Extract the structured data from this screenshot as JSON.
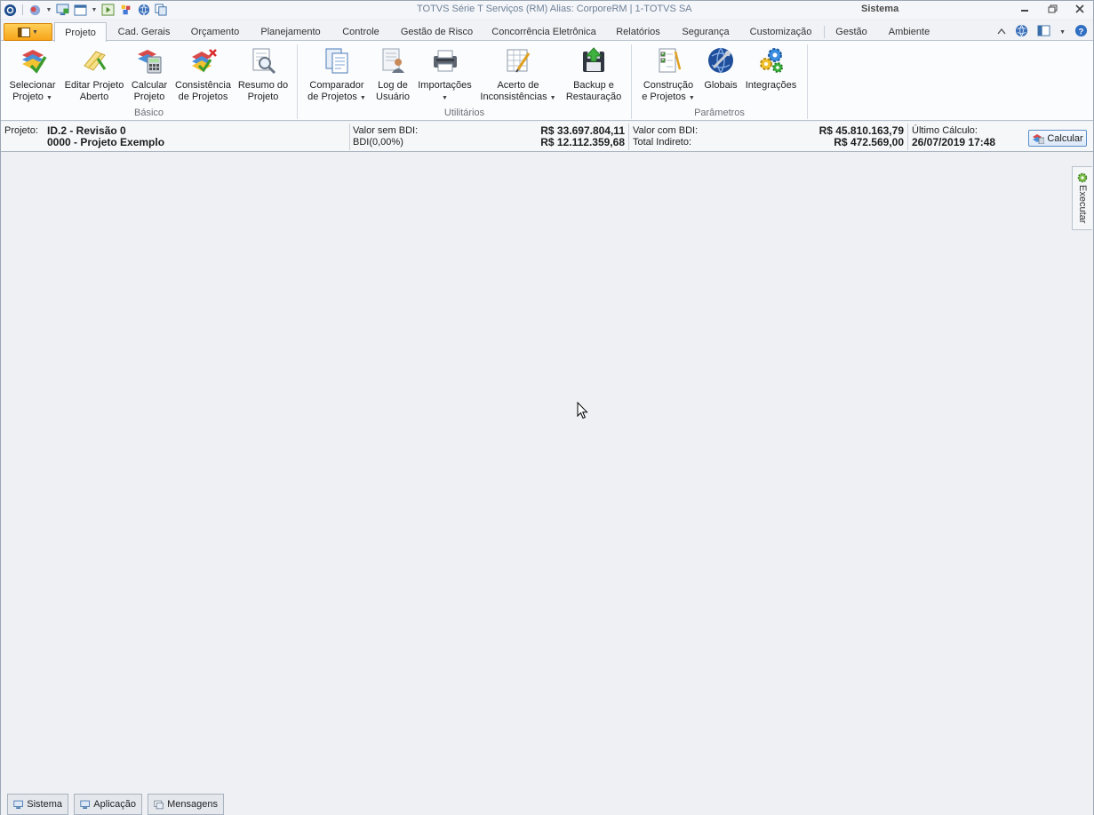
{
  "window": {
    "title": "TOTVS Série T Serviços (RM) Alias: CorporeRM | 1-TOTVS SA",
    "app_name": "Sistema"
  },
  "tabs": [
    {
      "label": "Projeto",
      "active": true
    },
    {
      "label": "Cad. Gerais"
    },
    {
      "label": "Orçamento"
    },
    {
      "label": "Planejamento"
    },
    {
      "label": "Controle"
    },
    {
      "label": "Gestão de Risco"
    },
    {
      "label": "Concorrência Eletrônica"
    },
    {
      "label": "Relatórios"
    },
    {
      "label": "Segurança"
    },
    {
      "label": "Customização"
    },
    {
      "label": "Gestão"
    },
    {
      "label": "Ambiente"
    }
  ],
  "ribbon": {
    "groups": [
      {
        "label": "Básico"
      },
      {
        "label": "Utilitários"
      },
      {
        "label": "Parâmetros"
      }
    ],
    "buttons": [
      {
        "line1": "Selecionar",
        "line2": "Projeto",
        "dropdown": true,
        "icon": "select-project-icon"
      },
      {
        "line1": "Editar Projeto",
        "line2": "Aberto",
        "icon": "edit-project-icon"
      },
      {
        "line1": "Calcular",
        "line2": "Projeto",
        "icon": "calculate-project-icon"
      },
      {
        "line1": "Consistência",
        "line2": "de Projetos",
        "icon": "consistency-icon"
      },
      {
        "line1": "Resumo do",
        "line2": "Projeto",
        "icon": "project-summary-icon"
      },
      {
        "line1": "Comparador",
        "line2": "de Projetos",
        "dropdown": true,
        "icon": "compare-icon"
      },
      {
        "line1": "Log de",
        "line2": "Usuário",
        "icon": "user-log-icon"
      },
      {
        "line1": "Importações",
        "line2": "",
        "dropdown": true,
        "icon": "import-icon"
      },
      {
        "line1": "Acerto de",
        "line2": "Inconsistências",
        "dropdown": true,
        "icon": "fix-inconsistencies-icon"
      },
      {
        "line1": "Backup e",
        "line2": "Restauração",
        "icon": "backup-icon"
      },
      {
        "line1": "Construção",
        "line2": "e Projetos",
        "dropdown": true,
        "icon": "construction-icon"
      },
      {
        "line1": "Globais",
        "line2": "",
        "icon": "globe-icon"
      },
      {
        "line1": "Integrações",
        "line2": "",
        "icon": "gears-icon"
      }
    ]
  },
  "project_info": {
    "label": "Projeto:",
    "id_line": "ID.2 - Revisão 0",
    "name_line": "0000 - Projeto Exemplo",
    "valor_sem_bdi_label": "Valor sem BDI:",
    "valor_sem_bdi": "R$ 33.697.804,11",
    "bdi_label": "BDI(0,00%)",
    "bdi_value": "R$ 12.112.359,68",
    "valor_com_bdi_label": "Valor com BDI:",
    "valor_com_bdi": "R$ 45.810.163,79",
    "total_indireto_label": "Total Indireto:",
    "total_indireto": "R$ 472.569,00",
    "ultimo_calculo_label": "Último Cálculo:",
    "ultimo_calculo": "26/07/2019 17:48",
    "calc_button": "Calcular"
  },
  "side_panel": {
    "label": "Executar"
  },
  "status_bar": [
    {
      "label": "Sistema"
    },
    {
      "label": "Aplicação"
    },
    {
      "label": "Mensagens"
    }
  ],
  "colors": {
    "app_button": "#f7a51a",
    "title_text": "#6e8097",
    "accent_blue": "#5b8fc9"
  }
}
